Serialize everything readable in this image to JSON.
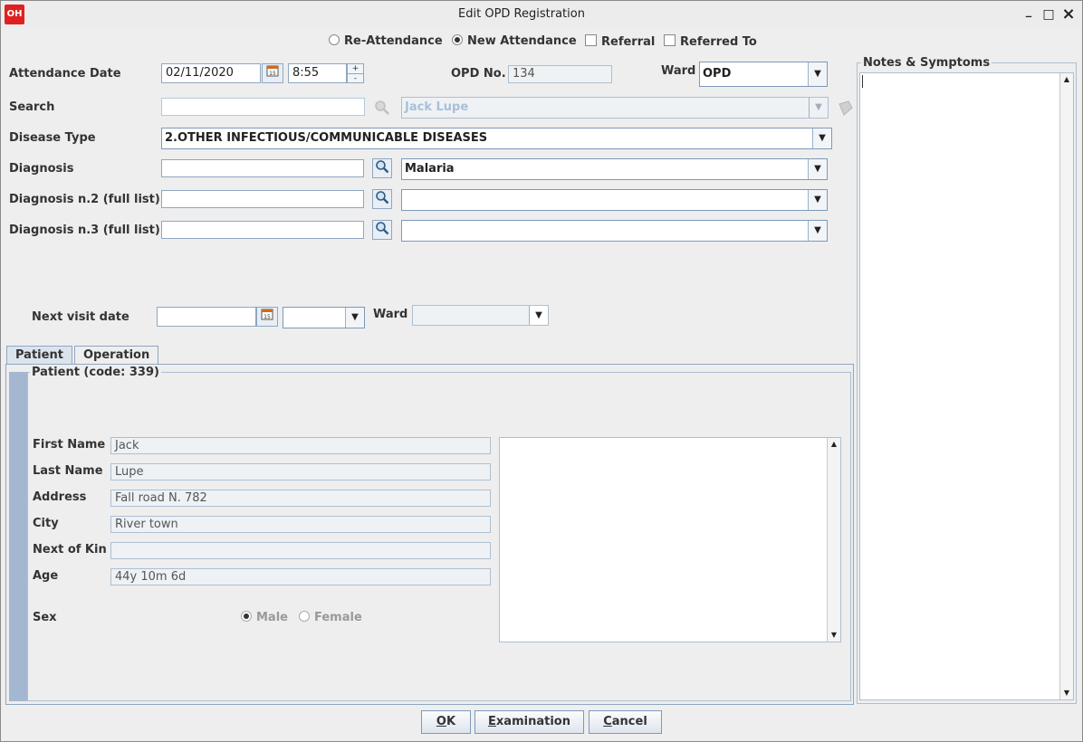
{
  "window": {
    "title": "Edit OPD Registration",
    "logo_text": "OH",
    "minimize": "_",
    "maximize": "□",
    "close": "×"
  },
  "attendance_type": {
    "re_attendance": "Re-Attendance",
    "new_attendance": "New Attendance",
    "referral": "Referral",
    "referred_to": "Referred To",
    "selected": "new_attendance"
  },
  "form": {
    "attendance_date_label": "Attendance Date",
    "attendance_date": "02/11/2020",
    "attendance_time": "8:55",
    "spinner_up": "+",
    "spinner_down": "-",
    "opd_no_label": "OPD No.",
    "opd_no": "134",
    "ward_label": "Ward",
    "ward": "OPD",
    "search_label": "Search",
    "search_value": "",
    "patient_selected": "Jack Lupe",
    "disease_type_label": "Disease Type",
    "disease_type": "2.OTHER INFECTIOUS/COMMUNICABLE DISEASES",
    "diagnosis_label": "Diagnosis",
    "diagnosis_search": "",
    "diagnosis": "Malaria",
    "diagnosis2_label": "Diagnosis n.2 (full list)",
    "diagnosis2_search": "",
    "diagnosis2": "",
    "diagnosis3_label": "Diagnosis n.3 (full list)",
    "diagnosis3_search": "",
    "diagnosis3": "",
    "next_visit_label": "Next visit date",
    "next_visit_date": "",
    "next_visit_time": "",
    "next_ward_label": "Ward",
    "next_ward": ""
  },
  "notes": {
    "title": "Notes & Symptoms",
    "text": ""
  },
  "tabs": [
    {
      "label": "Patient"
    },
    {
      "label": "Operation"
    }
  ],
  "patient": {
    "section_title": "Patient (code: 339)",
    "first_name_label": "First Name",
    "first_name": "Jack",
    "last_name_label": "Last Name",
    "last_name": "Lupe",
    "address_label": "Address",
    "address": "Fall road N. 782",
    "city_label": "City",
    "city": "River town",
    "next_of_kin_label": "Next of Kin",
    "next_of_kin": "",
    "age_label": "Age",
    "age": "44y 10m 6d",
    "sex_label": "Sex",
    "male": "Male",
    "female": "Female",
    "sex_selected": "male"
  },
  "buttons": {
    "ok_first": "O",
    "ok_rest": "K",
    "examination_first": "E",
    "examination_rest": "xamination",
    "cancel_first": "C",
    "cancel_rest": "ancel"
  }
}
